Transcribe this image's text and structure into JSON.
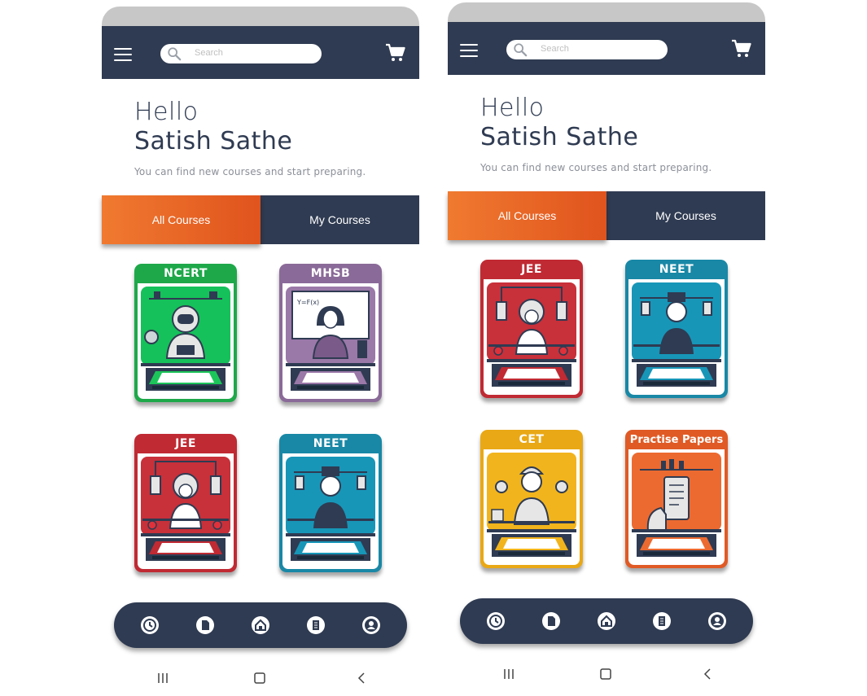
{
  "screens": [
    {
      "search_placeholder": "Search",
      "greeting": "Hello",
      "user_name": "Satish Sathe",
      "subtitle": "You can find new courses and start preparing.",
      "tabs": {
        "all": "All Courses",
        "my": "My Courses"
      },
      "cards": [
        {
          "title": "NCERT",
          "color": "#1ea84a",
          "art": "#15c15a"
        },
        {
          "title": "MHSB",
          "color": "#8a6a98",
          "art": "#9a78a8"
        },
        {
          "title": "JEE",
          "color": "#c02a33",
          "art": "#c8303a"
        },
        {
          "title": "NEET",
          "color": "#1988a6",
          "art": "#1796b8"
        }
      ]
    },
    {
      "search_placeholder": "Search",
      "greeting": "Hello",
      "user_name": "Satish Sathe",
      "subtitle": "You can find new courses and start preparing.",
      "tabs": {
        "all": "All Courses",
        "my": "My Courses"
      },
      "cards": [
        {
          "title": "JEE",
          "color": "#c02a33",
          "art": "#c8303a"
        },
        {
          "title": "NEET",
          "color": "#1988a6",
          "art": "#1796b8"
        },
        {
          "title": "CET",
          "color": "#e9a815",
          "art": "#f2b41c"
        },
        {
          "title": "Practise Papers",
          "color": "#e05a25",
          "art": "#ec6a30"
        }
      ]
    }
  ],
  "icons": {
    "menu": "hamburger-menu-icon",
    "search": "search-icon",
    "cart": "cart-icon",
    "nav": [
      "history-icon",
      "document-icon",
      "home-icon",
      "notes-icon",
      "profile-icon"
    ],
    "system": [
      "recent-apps-icon",
      "home-button-icon",
      "back-icon"
    ]
  },
  "colors": {
    "navy": "#2f3b52",
    "orange": "#f07a30"
  }
}
